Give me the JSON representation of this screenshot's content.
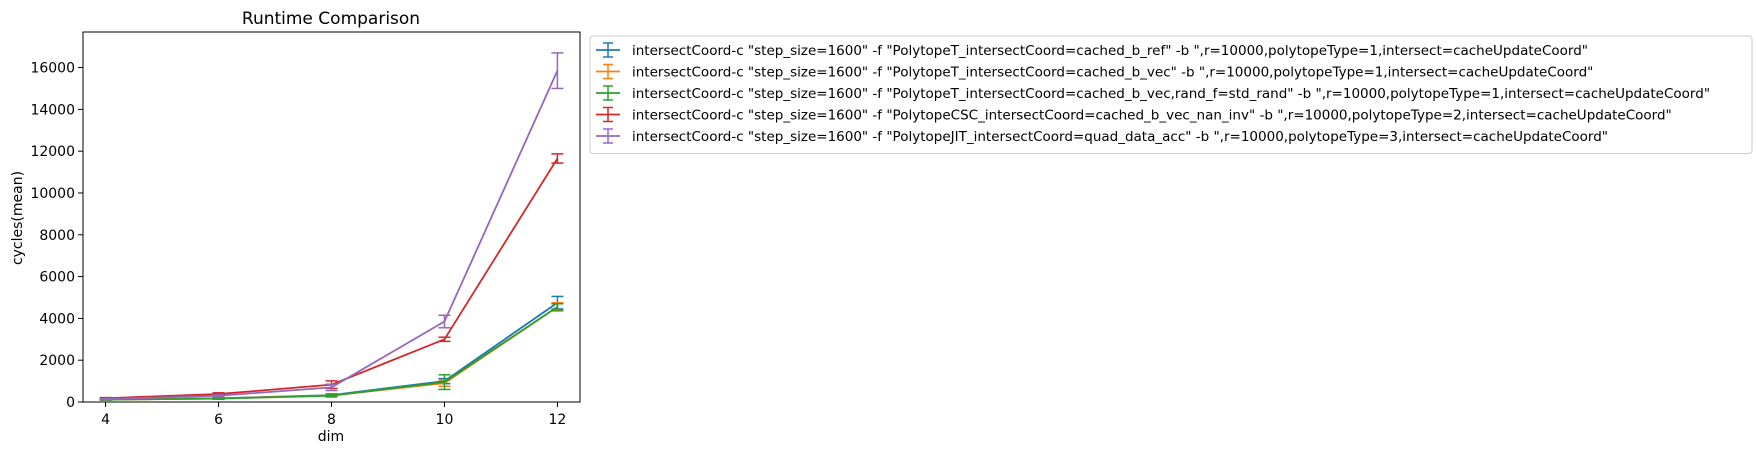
{
  "chart_data": {
    "type": "line",
    "title": "Runtime Comparison",
    "xlabel": "dim",
    "ylabel": "cycles(mean)",
    "x": [
      4,
      6,
      8,
      10,
      12
    ],
    "xticks": [
      "4",
      "6",
      "8",
      "10",
      "12"
    ],
    "yticks": [
      "0",
      "2000",
      "4000",
      "6000",
      "8000",
      "10000",
      "12000",
      "14000",
      "16000"
    ],
    "xlim": [
      3.6,
      12.4
    ],
    "ylim": [
      0,
      17700
    ],
    "legend_position": "outside-right",
    "grid": false,
    "series": [
      {
        "name": "intersectCoord-c \"step_size=1600\" -f \"PolytopeT_intersectCoord=cached_b_ref\" -b \",r=10000,polytopeType=1,intersect=cacheUpdateCoord\"",
        "color": "#1f77b4",
        "values": [
          120,
          180,
          330,
          1000,
          4750
        ],
        "err": [
          20,
          30,
          60,
          120,
          300
        ]
      },
      {
        "name": "intersectCoord-c \"step_size=1600\" -f \"PolytopeT_intersectCoord=cached_b_vec\" -b \",r=10000,polytopeType=1,intersect=cacheUpdateCoord\"",
        "color": "#ff7f0e",
        "values": [
          110,
          170,
          310,
          900,
          4550
        ],
        "err": [
          20,
          30,
          60,
          150,
          200
        ]
      },
      {
        "name": "intersectCoord-c \"step_size=1600\" -f \"PolytopeT_intersectCoord=cached_b_vec,rand_f=std_rand\" -b \",r=10000,polytopeType=1,intersect=cacheUpdateCoord\"",
        "color": "#2ca02c",
        "values": [
          110,
          160,
          300,
          950,
          4550
        ],
        "err": [
          20,
          30,
          60,
          350,
          150
        ]
      },
      {
        "name": "intersectCoord-c \"step_size=1600\" -f \"PolytopeCSC_intersectCoord=cached_b_vec_nan_inv\" -b \",r=10000,polytopeType=2,intersect=cacheUpdateCoord\"",
        "color": "#d62728",
        "values": [
          180,
          380,
          830,
          3000,
          11650
        ],
        "err": [
          30,
          60,
          180,
          100,
          220
        ]
      },
      {
        "name": "intersectCoord-c \"step_size=1600\" -f \"PolytopeJIT_intersectCoord=quad_data_acc\" -b \",r=10000,polytopeType=3,intersect=cacheUpdateCoord\"",
        "color": "#9467bd",
        "values": [
          140,
          300,
          700,
          3850,
          15850
        ],
        "err": [
          25,
          40,
          150,
          300,
          850
        ]
      }
    ]
  }
}
